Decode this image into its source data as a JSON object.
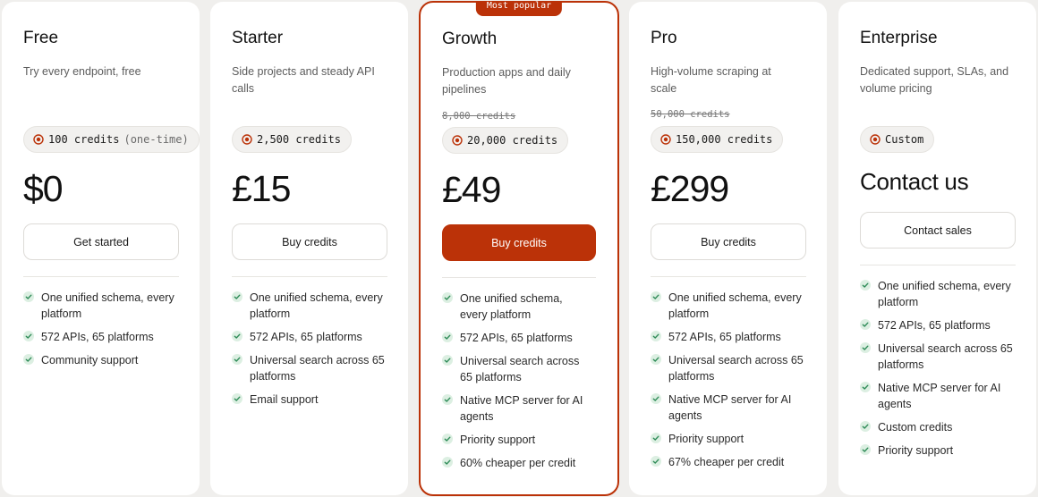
{
  "accent_color": "#bb3208",
  "plans": [
    {
      "name": "Free",
      "description": "Try every endpoint, free",
      "strike": "",
      "credits": "100 credits",
      "credits_extra": "(one-time)",
      "price": "$0",
      "cta": "Get started",
      "features": [
        "One unified schema, every platform",
        "572 APIs, 65 platforms",
        "Community support"
      ]
    },
    {
      "name": "Starter",
      "description": "Side projects and steady API calls",
      "strike": "",
      "credits": "2,500 credits",
      "credits_extra": "",
      "price": "£15",
      "cta": "Buy credits",
      "features": [
        "One unified schema, every platform",
        "572 APIs, 65 platforms",
        "Universal search across 65 platforms",
        "Email support"
      ]
    },
    {
      "name": "Growth",
      "badge": "Most popular",
      "description": "Production apps and daily pipelines",
      "strike": "8,000 credits",
      "credits": "20,000 credits",
      "credits_extra": "",
      "price": "£49",
      "cta": "Buy credits",
      "features": [
        "One unified schema, every platform",
        "572 APIs, 65 platforms",
        "Universal search across 65 platforms",
        "Native MCP server for AI agents",
        "Priority support",
        "60% cheaper per credit"
      ]
    },
    {
      "name": "Pro",
      "description": "High-volume scraping at scale",
      "strike": "50,000 credits",
      "credits": "150,000 credits",
      "credits_extra": "",
      "price": "£299",
      "cta": "Buy credits",
      "features": [
        "One unified schema, every platform",
        "572 APIs, 65 platforms",
        "Universal search across 65 platforms",
        "Native MCP server for AI agents",
        "Priority support",
        "67% cheaper per credit"
      ]
    },
    {
      "name": "Enterprise",
      "description": "Dedicated support, SLAs, and volume pricing",
      "strike": "",
      "credits": "Custom",
      "credits_extra": "",
      "price": "Contact us",
      "cta": "Contact sales",
      "features": [
        "One unified schema, every platform",
        "572 APIs, 65 platforms",
        "Universal search across 65 platforms",
        "Native MCP server for AI agents",
        "Custom credits",
        "Priority support"
      ]
    }
  ]
}
